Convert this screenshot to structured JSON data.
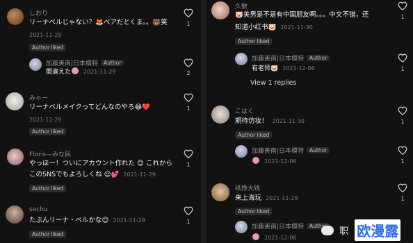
{
  "author_chip": "Author",
  "author_liked": "Author liked",
  "left": {
    "comments": [
      {
        "name": "しおり",
        "text": "リーナベルじゃない？🦊ペアだとくま。。🐻",
        "text_tail": "笑",
        "date": "2021-11-29",
        "likes": "1"
      },
      {
        "name": "加藤美南|日本模特",
        "text": "間違えた",
        "date": "2021-11-29",
        "likes": "2"
      },
      {
        "name": "みゃー",
        "text": "リーナベルメイクってどんなのやろ😂❤️",
        "date": "2021-11-29",
        "likes": "1"
      },
      {
        "name": "Floris—みな民",
        "text": "やっほー！ついにアカウント作れた 😊 これから",
        "text2": "このSNSでもよろしくね 😌💕",
        "date": "2021-11-29",
        "likes": "1"
      },
      {
        "name": "sechu",
        "text": "たぶんリーナ・ベルかな😊",
        "date": "2021-11-29",
        "likes": "1"
      }
    ]
  },
  "right": {
    "comments": [
      {
        "name": "久敏",
        "text": "🐷美男是不是有中国朋友啊。。。中文不错，还",
        "text2": "知道小红书🐷",
        "date": "2021-11-30",
        "likes": "1"
      },
      {
        "name": "加藤美南|日本模特",
        "text": "有老师🐷",
        "date": "2021-12-06",
        "likes": "1"
      },
      {
        "name": "こはく",
        "text": "期待仿妆！",
        "date": "2021-11-30",
        "likes": "1"
      },
      {
        "name": "加藤美南|日本模特",
        "text": "",
        "date": "2021-12-06",
        "likes": "1"
      },
      {
        "name": "纸挣大钱",
        "text": "来上海玩",
        "date": "2021-11-29",
        "likes": "1"
      },
      {
        "name": "加藤美南|日本模特",
        "text": "",
        "date": "2021-12-06",
        "likes": ""
      }
    ],
    "view_replies": "View 1 replies"
  },
  "watermark": {
    "label": "职",
    "brand": "欧漫露"
  },
  "colors": {
    "bg": "#121212",
    "chip": "#2b2b2b",
    "muted": "#8e8e8e"
  }
}
